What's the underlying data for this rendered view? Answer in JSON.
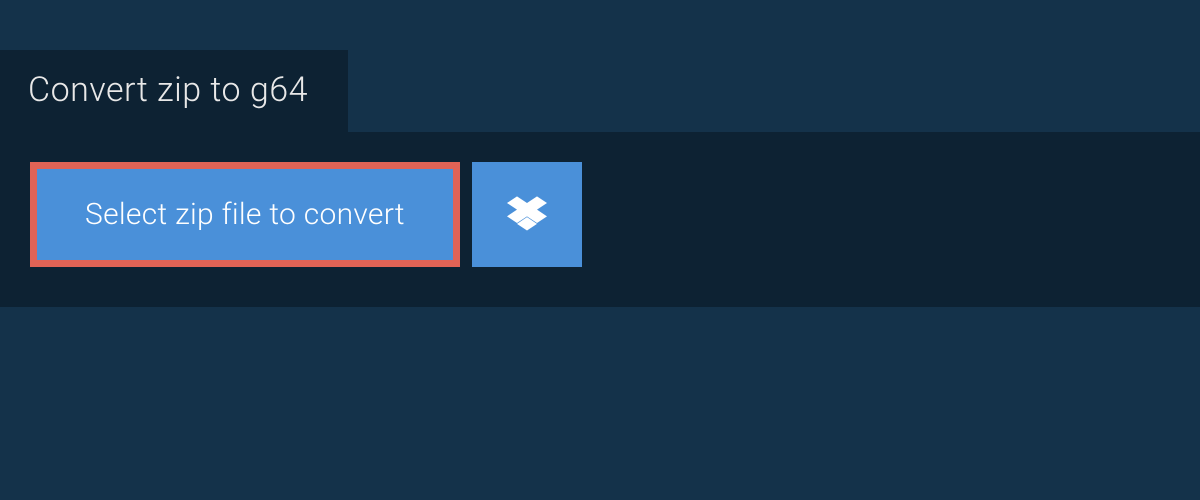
{
  "tab": {
    "label": "Convert zip to g64"
  },
  "actions": {
    "select_label": "Select zip file to convert"
  },
  "colors": {
    "page_bg": "#14324a",
    "panel_bg": "#0d2233",
    "button_bg": "#4a90d9",
    "highlight_border": "#e06356",
    "text_light": "#ffffff"
  }
}
